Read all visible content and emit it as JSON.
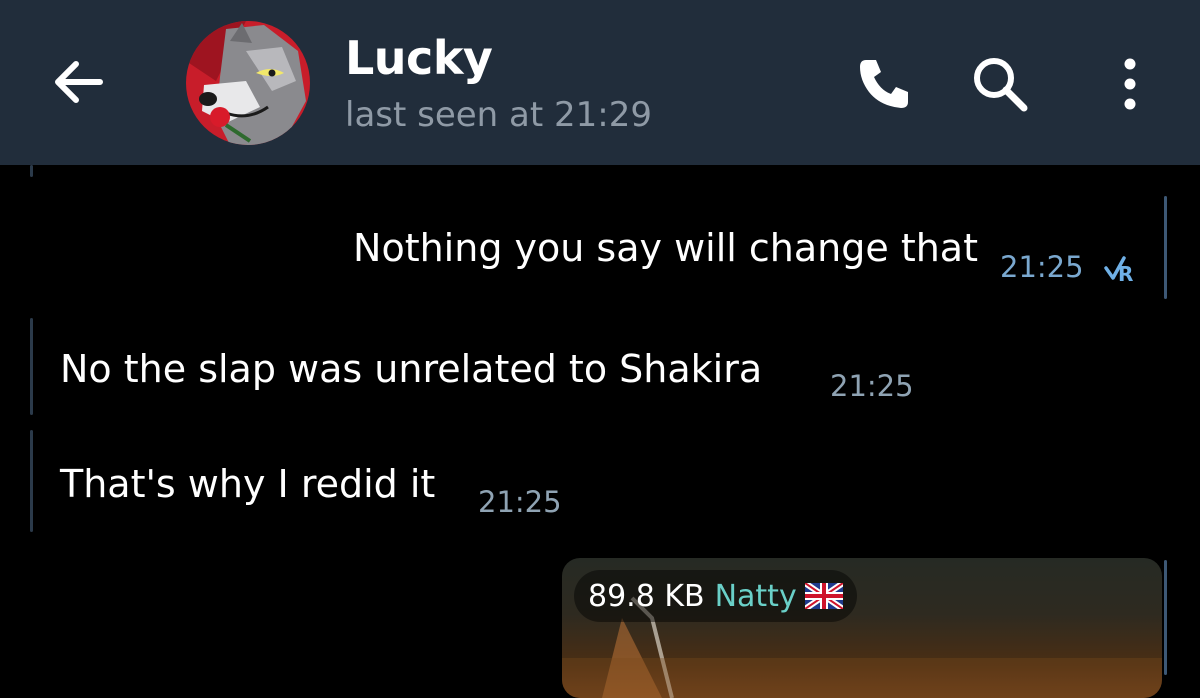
{
  "header": {
    "title": "Lucky",
    "subtitle": "last seen at 21:29"
  },
  "messages": [
    {
      "text": "Nothing you say will change that",
      "time": "21:25",
      "direction": "outgoing",
      "status": "read"
    },
    {
      "text": "No the slap was unrelated to Shakira",
      "time": "21:25",
      "direction": "incoming"
    },
    {
      "text": "That's why I redid it",
      "time": "21:25",
      "direction": "incoming"
    }
  ],
  "photo_message": {
    "size": "89.8 KB",
    "sender": "Natty"
  },
  "colors": {
    "header_bg": "#212d3b",
    "chat_bg": "#000000",
    "accent": "#7aa8cf",
    "sender_color": "#6ad0c8"
  },
  "icons": [
    "back-arrow-icon",
    "phone-icon",
    "search-icon",
    "more-vertical-icon",
    "read-receipt-icon",
    "uk-flag-icon"
  ]
}
